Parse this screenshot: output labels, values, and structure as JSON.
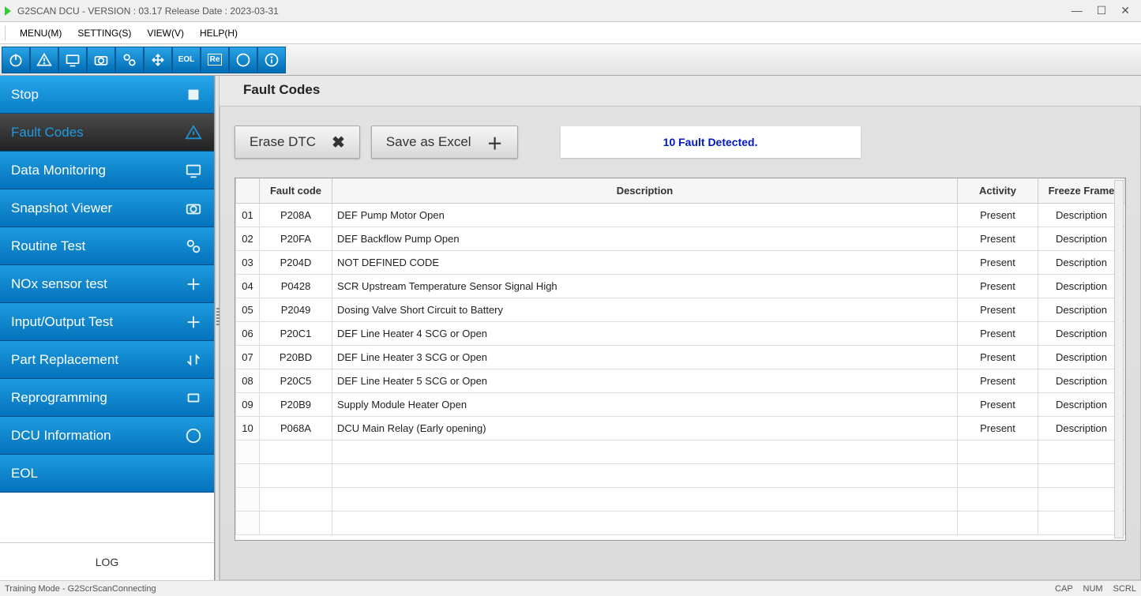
{
  "window": {
    "title": "G2SCAN DCU - VERSION : 03.17 Release Date : 2023-03-31"
  },
  "menubar": {
    "items": [
      "MENU(M)",
      "SETTING(S)",
      "VIEW(V)",
      "HELP(H)"
    ]
  },
  "toolbar": {
    "icons": [
      "power-icon",
      "warning-icon",
      "monitor-icon",
      "camera-icon",
      "gears-icon",
      "arrows-icon",
      "eol-icon",
      "re-icon",
      "ecu-icon",
      "info-icon"
    ]
  },
  "sidebar": {
    "items": [
      {
        "label": "Stop",
        "icon": "stop-icon",
        "active": false
      },
      {
        "label": "Fault Codes",
        "icon": "warning-icon",
        "active": true
      },
      {
        "label": "Data Monitoring",
        "icon": "monitor-icon",
        "active": false
      },
      {
        "label": "Snapshot Viewer",
        "icon": "camera-icon",
        "active": false
      },
      {
        "label": "Routine Test",
        "icon": "gears-icon",
        "active": false
      },
      {
        "label": "NOx sensor test",
        "icon": "arrows-icon",
        "active": false
      },
      {
        "label": "Input/Output Test",
        "icon": "arrows-icon",
        "active": false
      },
      {
        "label": "Part Replacement",
        "icon": "swap-icon",
        "active": false
      },
      {
        "label": "Reprogramming",
        "icon": "re-icon",
        "active": false
      },
      {
        "label": "DCU Information",
        "icon": "ecu-icon",
        "active": false
      },
      {
        "label": "EOL",
        "icon": "",
        "active": false
      }
    ],
    "log_label": "LOG"
  },
  "content": {
    "title": "Fault Codes",
    "erase_label": "Erase DTC",
    "save_label": "Save as Excel",
    "status_text": "10 Fault Detected.",
    "columns": {
      "idx": "",
      "code": "Fault code",
      "desc": "Description",
      "activity": "Activity",
      "ff": "Freeze Frame"
    },
    "rows": [
      {
        "idx": "01",
        "code": "P208A",
        "desc": "DEF Pump Motor Open",
        "activity": "Present",
        "ff": "Description"
      },
      {
        "idx": "02",
        "code": "P20FA",
        "desc": "DEF Backflow Pump Open",
        "activity": "Present",
        "ff": "Description"
      },
      {
        "idx": "03",
        "code": "P204D",
        "desc": "NOT DEFINED CODE",
        "activity": "Present",
        "ff": "Description"
      },
      {
        "idx": "04",
        "code": "P0428",
        "desc": "SCR Upstream Temperature Sensor Signal High",
        "activity": "Present",
        "ff": "Description"
      },
      {
        "idx": "05",
        "code": "P2049",
        "desc": "Dosing Valve Short Circuit to Battery",
        "activity": "Present",
        "ff": "Description"
      },
      {
        "idx": "06",
        "code": "P20C1",
        "desc": "DEF Line Heater 4 SCG or Open",
        "activity": "Present",
        "ff": "Description"
      },
      {
        "idx": "07",
        "code": "P20BD",
        "desc": "DEF Line Heater 3 SCG or Open",
        "activity": "Present",
        "ff": "Description"
      },
      {
        "idx": "08",
        "code": "P20C5",
        "desc": "DEF Line Heater 5 SCG or Open",
        "activity": "Present",
        "ff": "Description"
      },
      {
        "idx": "09",
        "code": "P20B9",
        "desc": "Supply Module Heater Open",
        "activity": "Present",
        "ff": "Description"
      },
      {
        "idx": "10",
        "code": "P068A",
        "desc": "DCU Main Relay (Early opening)",
        "activity": "Present",
        "ff": "Description"
      }
    ],
    "empty_rows": 4
  },
  "statusbar": {
    "left": "Training Mode - G2ScrScanConnecting",
    "caps": "CAP",
    "num": "NUM",
    "scrl": "SCRL"
  }
}
